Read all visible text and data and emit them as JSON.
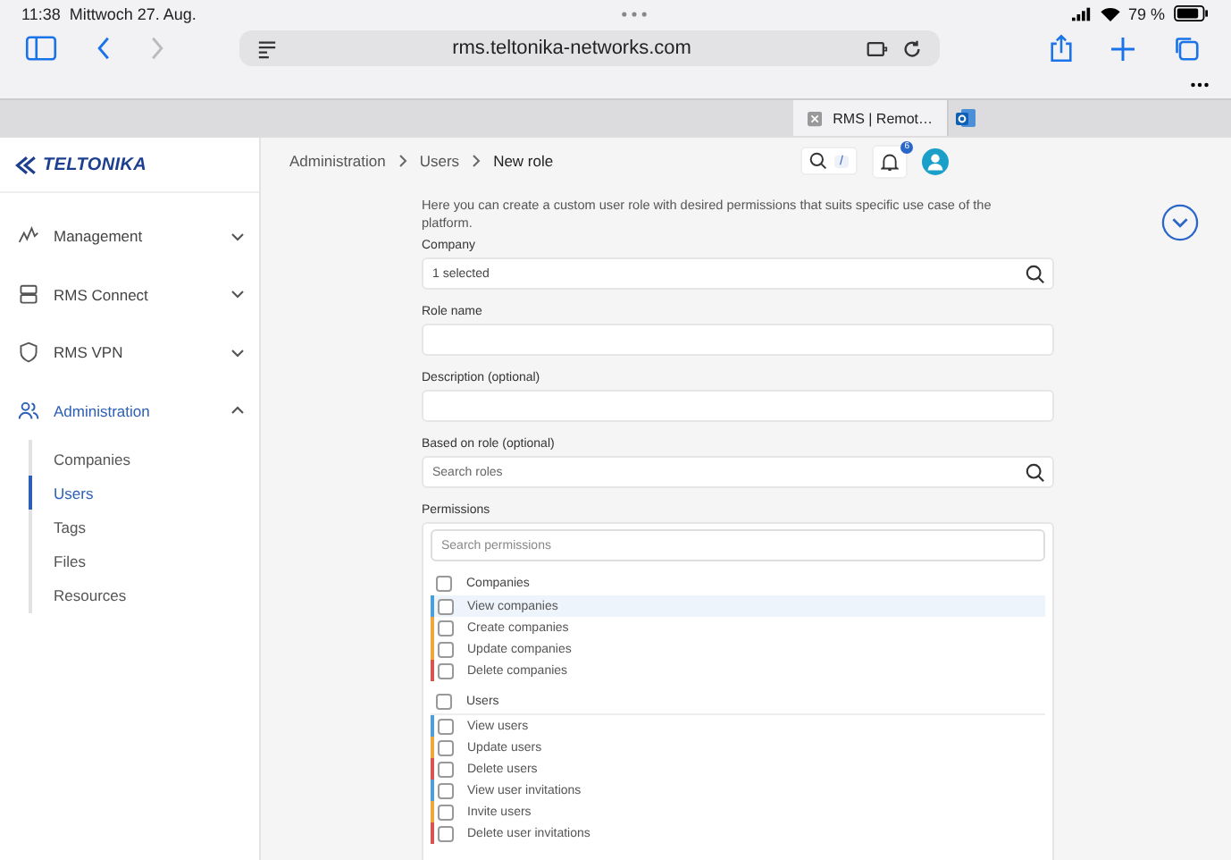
{
  "status_bar": {
    "time": "11:38",
    "date": "Mittwoch 27. Aug.",
    "battery": "79 %"
  },
  "browser": {
    "url": "rms.teltonika-networks.com",
    "tabs": [
      {
        "label": "RMS | Remot…",
        "selected": true
      }
    ]
  },
  "sidebar": {
    "logo": "TELTONIKA",
    "items": [
      {
        "label": "Management",
        "expanded": false,
        "selected": false
      },
      {
        "label": "RMS Connect",
        "expanded": false,
        "selected": false
      },
      {
        "label": "RMS VPN",
        "expanded": false,
        "selected": false
      },
      {
        "label": "Administration",
        "expanded": true,
        "selected": true,
        "children": [
          {
            "label": "Companies",
            "selected": false
          },
          {
            "label": "Users",
            "selected": true
          },
          {
            "label": "Tags",
            "selected": false
          },
          {
            "label": "Files",
            "selected": false
          },
          {
            "label": "Resources",
            "selected": false
          }
        ]
      }
    ]
  },
  "header": {
    "breadcrumb": [
      "Administration",
      "Users",
      "New role"
    ],
    "shortcut": "/",
    "notification_count": "6"
  },
  "form": {
    "intro": "Here you can create a custom user role with desired permissions that suits specific use case of the platform.",
    "fields": [
      {
        "label": "Company",
        "kind": "search",
        "value": "1 selected"
      },
      {
        "label": "Role name",
        "kind": "text"
      },
      {
        "label": "Description (optional)",
        "kind": "text"
      },
      {
        "label": "Based on role (optional)",
        "kind": "search",
        "placeholder": "Search roles"
      }
    ],
    "permissions": {
      "label": "Permissions",
      "placeholder": "Search permissions",
      "groups": [
        {
          "label": "Companies",
          "checked": false,
          "items": [
            {
              "label": "View companies",
              "checked": false,
              "selected": true,
              "color": "#4a9fd8"
            },
            {
              "label": "Create companies",
              "checked": false,
              "selected": false,
              "color": "#f0a63a"
            },
            {
              "label": "Update companies",
              "checked": false,
              "selected": false,
              "color": "#f0a63a"
            },
            {
              "label": "Delete companies",
              "checked": false,
              "selected": false,
              "color": "#d9534f"
            }
          ]
        },
        {
          "label": "Users",
          "checked": false,
          "items": [
            {
              "label": "View users",
              "checked": false,
              "selected": false,
              "color": "#4a9fd8"
            },
            {
              "label": "Update users",
              "checked": false,
              "selected": false,
              "color": "#f0a63a"
            },
            {
              "label": "Delete users",
              "checked": false,
              "selected": false,
              "color": "#d9534f"
            },
            {
              "label": "View user invitations",
              "checked": false,
              "selected": false,
              "color": "#4a9fd8"
            },
            {
              "label": "Invite users",
              "checked": false,
              "selected": false,
              "color": "#f0a63a"
            },
            {
              "label": "Delete user invitations",
              "checked": false,
              "selected": false,
              "color": "#d9534f"
            }
          ]
        }
      ]
    }
  }
}
